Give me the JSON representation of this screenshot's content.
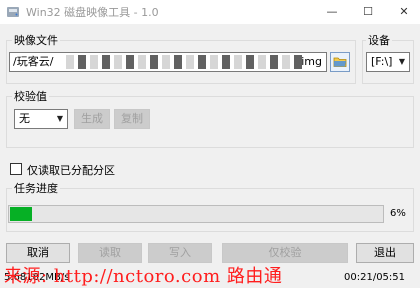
{
  "window": {
    "title": "Win32 磁盘映像工具 - 1.0",
    "minimize": "—",
    "maximize": "☐",
    "close": "✕",
    "icon": "disk-imager-icon"
  },
  "image_file": {
    "label": "映像文件",
    "path_prefix": "/玩客云/",
    "path_suffix": "img",
    "browse_icon": "folder-icon"
  },
  "device": {
    "label": "设备",
    "selected": "[F:\\]"
  },
  "hash": {
    "label": "校验值",
    "selected": "无",
    "generate_label": "生成",
    "copy_label": "复制"
  },
  "read_only_allocated": {
    "label": "仅读取已分配分区",
    "checked": false
  },
  "progress": {
    "label": "任务进度",
    "percent_text": "6%",
    "value": 0.06,
    "color": "#06b025"
  },
  "actions": {
    "cancel": "取消",
    "read": "读取",
    "write": "写入",
    "verify": "仅校验",
    "exit": "退出"
  },
  "status": {
    "speed": "5.68182MB/s",
    "time": "00:21/05:51"
  },
  "watermark": {
    "text": "来源: http://nctoro.com 路由通",
    "color": "#ff1e1e"
  }
}
